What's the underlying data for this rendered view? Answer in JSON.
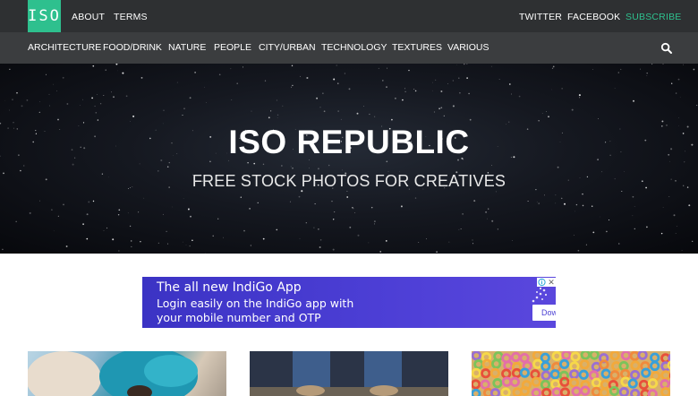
{
  "header": {
    "logo_text": "ISO",
    "left_links": [
      "ABOUT",
      "TERMS"
    ],
    "right_links": [
      "TWITTER",
      "FACEBOOK"
    ],
    "subscribe_label": "SUBSCRIBE",
    "accent_color": "#2ec08e"
  },
  "categories": [
    "ARCHITECTURE",
    "FOOD/DRINK",
    "NATURE",
    "PEOPLE",
    "CITY/URBAN",
    "TECHNOLOGY",
    "TEXTURES",
    "VARIOUS"
  ],
  "search": {
    "icon": "search-icon"
  },
  "hero": {
    "title": "ISO REPUBLIC",
    "subtitle": "FREE STOCK PHOTOS FOR CREATIVES"
  },
  "ad": {
    "line1": "The all new IndiGo App",
    "line2": "Login easily on the IndiGo app with",
    "line3": "your mobile number and OTP",
    "button_label": "Download now",
    "close_label": "✕",
    "background_color": "#4a3fd3"
  },
  "thumbnails": [
    {
      "subject": "person with blue hair lying down"
    },
    {
      "subject": "jeans and shoes from above"
    },
    {
      "subject": "colorful cereal rings"
    }
  ]
}
